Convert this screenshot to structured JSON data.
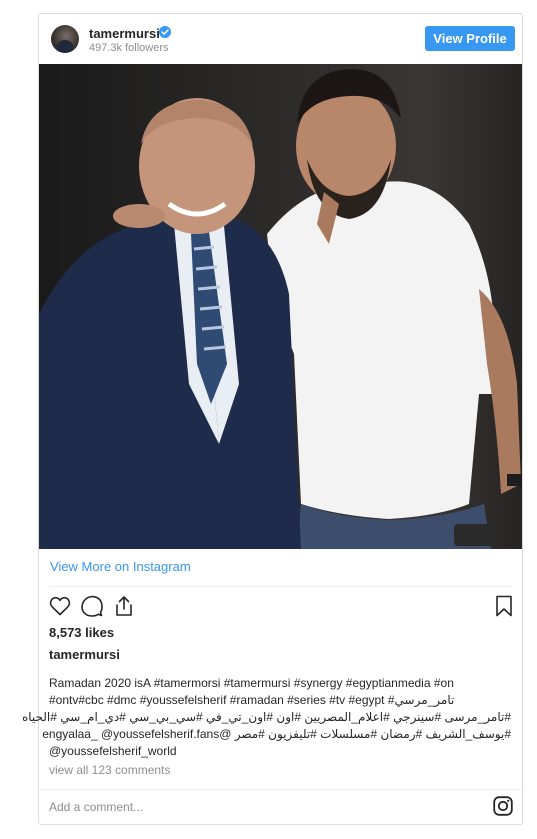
{
  "header": {
    "username": "tamermursi",
    "followers": "497.3k followers",
    "view_profile_label": "View Profile"
  },
  "colors": {
    "accent": "#3897f0",
    "text": "#262626",
    "muted": "#8e8e8e"
  },
  "post": {
    "view_more_label": "View More on Instagram",
    "likes": "8,573 likes",
    "owner": "tamermursi",
    "caption_lines": [
      "Ramadan 2020 isA #tamermorsi #tamermursi #synergy #egyptianmedia #on",
      "#ontv#cbc #dmc #youssefelsherif #ramadan #series #tv #egypt #تامر_مرسي",
      "#تامر_مرسى #سينرجي #اعلام_المصريين #اون #اون_تي_في #سي_بي_سي #دي_ام_سي #الحياه",
      "#يوسف_الشريف #رمضان #مسلسلات #تليفزيون #مصر @engyalaa_ @youssefelsherif.fans",
      "@youssefelsherif_world"
    ],
    "comments_link": "view all 123 comments",
    "comment_placeholder": "Add a comment..."
  },
  "icons": {
    "verified": "verified-badge-icon",
    "like": "heart-icon",
    "comment": "comment-icon",
    "share": "share-icon",
    "save": "bookmark-icon",
    "instagram": "instagram-logo-icon"
  }
}
